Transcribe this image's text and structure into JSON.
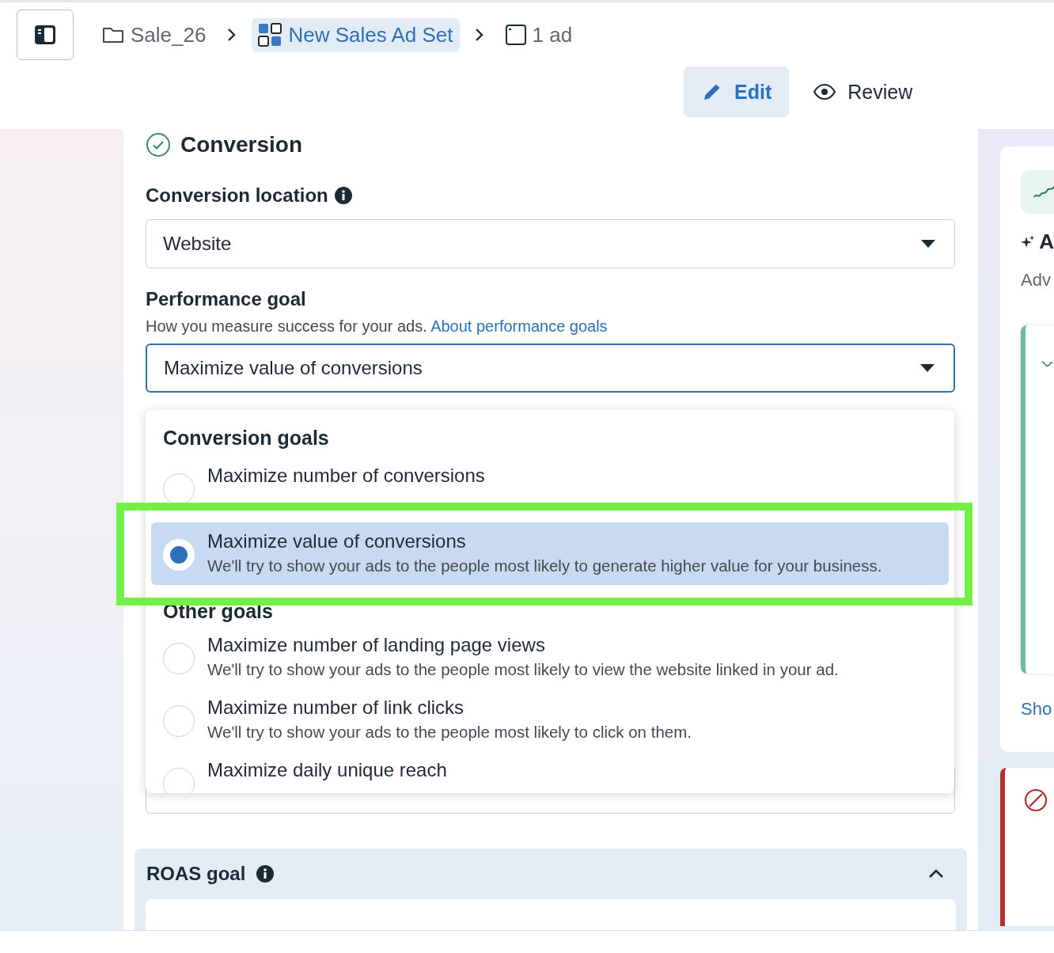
{
  "breadcrumb": [
    {
      "label": "Sale_26",
      "kind": "folder",
      "selected": false
    },
    {
      "label": "New Sales Ad Set",
      "kind": "adset",
      "selected": true
    },
    {
      "label": "1 ad",
      "kind": "ad",
      "selected": false
    }
  ],
  "mode_tabs": [
    {
      "label": "Edit",
      "kind": "edit",
      "selected": true
    },
    {
      "label": "Review",
      "kind": "review",
      "selected": false
    }
  ],
  "section": {
    "title": "Conversion",
    "complete": true
  },
  "conversion_location": {
    "label": "Conversion location",
    "value": "Website"
  },
  "performance_goal": {
    "label": "Performance goal",
    "help": "How you measure success for your ads.",
    "link": "About performance goals",
    "value": "Maximize value of conversions"
  },
  "goal_menu": {
    "groups": [
      {
        "heading": "Conversion goals",
        "options": [
          {
            "title": "Maximize number of conversions",
            "selected": false
          },
          {
            "title": "Maximize value of conversions",
            "description": "We'll try to show your ads to the people most likely to generate higher value for your business.",
            "selected": true
          }
        ]
      },
      {
        "heading": "Other goals",
        "options": [
          {
            "title": "Maximize number of landing page views",
            "description": "We'll try to show your ads to the people most likely to view the website linked in your ad.",
            "selected": false
          },
          {
            "title": "Maximize number of link clicks",
            "description": "We'll try to show your ads to the people most likely to click on them.",
            "selected": false
          },
          {
            "title": "Maximize daily unique reach",
            "selected": false
          }
        ]
      }
    ]
  },
  "roas_goal": {
    "label": "ROAS goal",
    "expanded": true
  },
  "side_panel": {
    "title": "A",
    "text": "Adv",
    "link": "Sho"
  }
}
